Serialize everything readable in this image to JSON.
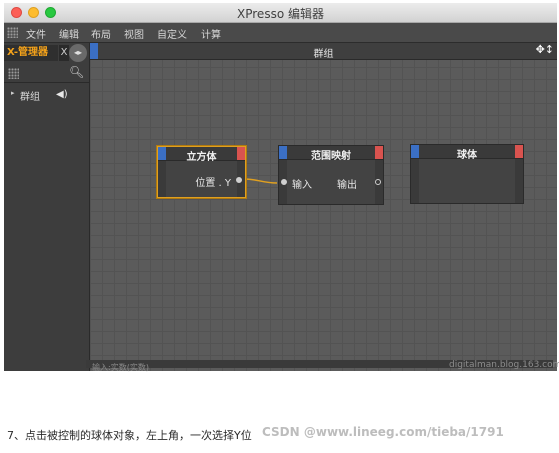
{
  "window": {
    "title": "XPresso 编辑器"
  },
  "menu": [
    "文件",
    "编辑",
    "布局",
    "视图",
    "自定义",
    "计算"
  ],
  "left_panel": {
    "tab_active": "X-管理器",
    "tab_second": "X",
    "tab_arrows": "◂▸",
    "tree": [
      {
        "label": "群组"
      }
    ]
  },
  "group": {
    "title": "群组"
  },
  "nodes": {
    "cube": {
      "title": "立方体",
      "output_port": "位置 . Y"
    },
    "rangemap": {
      "title": "范围映射",
      "input_port": "输入",
      "output_port": "输出"
    },
    "sphere": {
      "title": "球体"
    }
  },
  "status": {
    "text": "输入:实数(实数)"
  },
  "watermark": "digitalman.blog.163.com",
  "caption": {
    "text": "7、点击被控制的球体对象，左上角，一次选择Y位",
    "overlay": "CSDN @www.lineeg.com/tieba/1791"
  },
  "colors": {
    "selection": "#e0a020",
    "wire": "#e0a020",
    "port_blue": "#3b6fc4",
    "port_red": "#d9534f"
  }
}
